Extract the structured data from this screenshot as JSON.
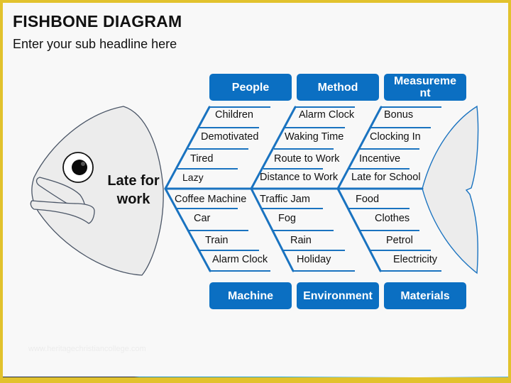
{
  "header": {
    "title": "FISHBONE DIAGRAM",
    "subtitle": "Enter your sub headline here"
  },
  "colors": {
    "accent": "#0b6fc2",
    "line": "#1a73c0",
    "fish_fill": "#ececec",
    "border": "#e2c22d"
  },
  "problem": {
    "line1": "Late for",
    "line2": "work"
  },
  "categories": {
    "top": [
      "People",
      "Method",
      "Measurement"
    ],
    "top_third_wrapped": [
      "Measureme",
      "nt"
    ],
    "bottom": [
      "Machine",
      "Environment",
      "Materials"
    ]
  },
  "causes": {
    "people": [
      "Children",
      "Demotivated",
      "Tired",
      "Lazy"
    ],
    "method": [
      "Alarm Clock",
      "Waking Time",
      "Route to Work",
      "Distance to Work"
    ],
    "measurement": [
      "Bonus",
      "Clocking In",
      "Incentive",
      "Late for School"
    ],
    "machine": [
      "Coffee Machine",
      "Car",
      "Train",
      "Alarm Clock"
    ],
    "environment": [
      "Traffic Jam",
      "Fog",
      "Rain",
      "Holiday"
    ],
    "materials": [
      "Food",
      "Clothes",
      "Petrol",
      "Electricity"
    ]
  },
  "icons": {
    "eye": "eye-icon"
  },
  "footer": {
    "watermark": "www.heritagechristiancollege.com"
  }
}
